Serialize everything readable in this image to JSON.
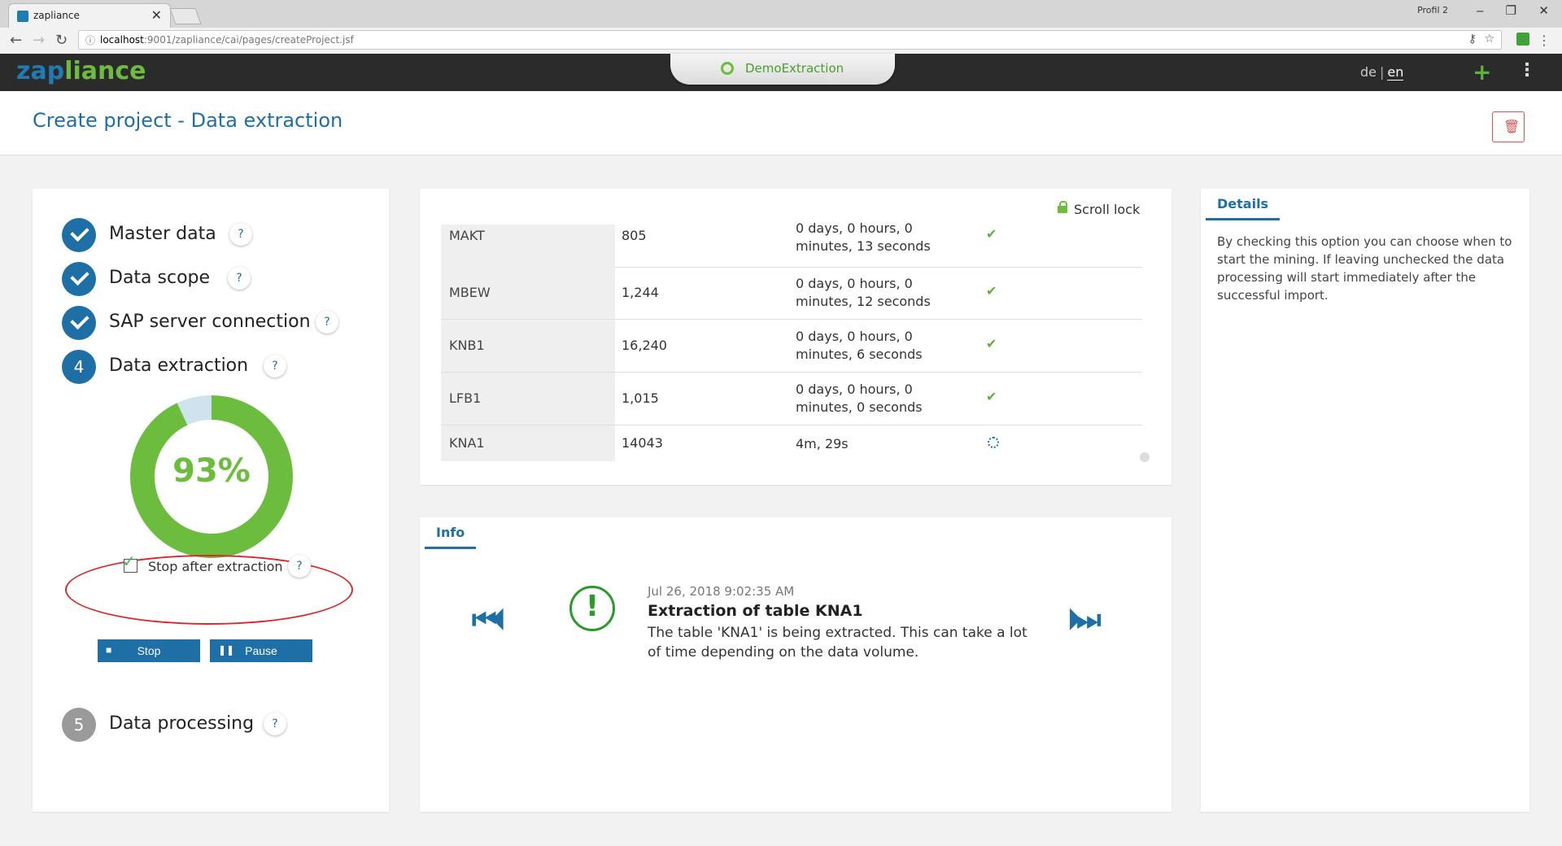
{
  "browser": {
    "tab_title": "zapliance",
    "tab_close": "✕",
    "profile": "Profil 2",
    "url_host": "localhost",
    "url_path": ":9001/zapliance/cai/pages/createProject.jsf"
  },
  "app": {
    "logo_part1": "zap",
    "logo_part2": "liance",
    "center_tab": "DemoExtraction",
    "lang_de": "de",
    "lang_sep": "|",
    "lang_en": "en"
  },
  "page": {
    "title": "Create project - Data extraction"
  },
  "steps": [
    {
      "number": "",
      "label": "Master data",
      "state": "done"
    },
    {
      "number": "",
      "label": "Data scope",
      "state": "done"
    },
    {
      "number": "",
      "label": "SAP server connection",
      "state": "done"
    },
    {
      "number": "4",
      "label": "Data extraction",
      "state": "active"
    },
    {
      "number": "5",
      "label": "Data processing",
      "state": "pending"
    }
  ],
  "help_label": "?",
  "progress": {
    "value": 93,
    "text": "93%",
    "color": "#6cbd3d",
    "remaining_color": "#cfe3ec"
  },
  "stop_after": {
    "label": "Stop after extraction",
    "checked": true
  },
  "buttons": {
    "stop": "Stop",
    "pause": "Pause"
  },
  "table": {
    "scroll_lock": "Scroll lock",
    "rows": [
      {
        "name": "MAKT",
        "count": "805",
        "dur1": "0 days, 0 hours, 0",
        "dur2": "minutes, 13 seconds",
        "status": "done"
      },
      {
        "name": "MBEW",
        "count": "1,244",
        "dur1": "0 days, 0 hours, 0",
        "dur2": "minutes, 12 seconds",
        "status": "done"
      },
      {
        "name": "KNB1",
        "count": "16,240",
        "dur1": "0 days, 0 hours, 0",
        "dur2": "minutes, 6 seconds",
        "status": "done"
      },
      {
        "name": "LFB1",
        "count": "1,015",
        "dur1": "0 days, 0 hours, 0",
        "dur2": "minutes, 0 seconds",
        "status": "done"
      },
      {
        "name": "KNA1",
        "count": "14043",
        "dur1": "4m, 29s",
        "dur2": "",
        "status": "running"
      }
    ]
  },
  "info": {
    "tab": "Info",
    "date": "Jul 26, 2018 9:02:35 AM",
    "title": "Extraction of table KNA1",
    "body": "The table 'KNA1' is being extracted. This can take a lot of time depending on the data volume."
  },
  "details": {
    "tab": "Details",
    "text": "By checking this option you can choose when to start the mining. If leaving unchecked the data processing will start immediately after the successful import."
  }
}
